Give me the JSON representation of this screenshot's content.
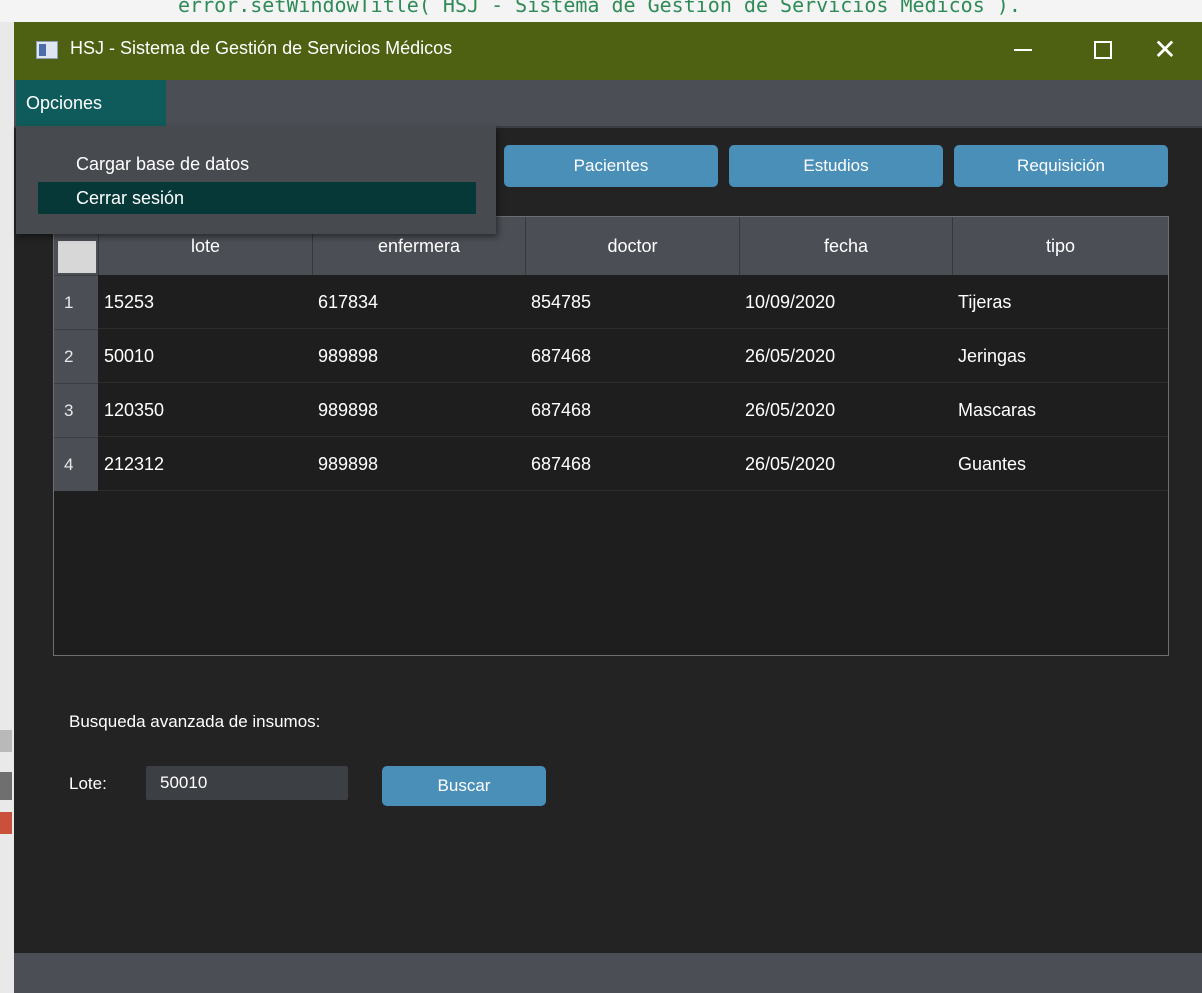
{
  "background": {
    "code_line": "error.setWindowTitle( HSJ - Sistema de Gestion de Servicios Medicos )."
  },
  "window": {
    "title": "HSJ - Sistema de Gestión de Servicios Médicos",
    "close_glyph": "✕"
  },
  "menu": {
    "opciones": "Opciones",
    "items": [
      {
        "label": "Cargar base de datos"
      },
      {
        "label": "Cerrar sesión"
      }
    ]
  },
  "toolbar": {
    "pacientes": "Pacientes",
    "estudios": "Estudios",
    "requisicion": "Requisición"
  },
  "table": {
    "columns": [
      "lote",
      "enfermera",
      "doctor",
      "fecha",
      "tipo"
    ],
    "rows": [
      {
        "num": "1",
        "cells": [
          "15253",
          "617834",
          "854785",
          "10/09/2020",
          "Tijeras"
        ]
      },
      {
        "num": "2",
        "cells": [
          "50010",
          "989898",
          "687468",
          "26/05/2020",
          "Jeringas"
        ]
      },
      {
        "num": "3",
        "cells": [
          "120350",
          "989898",
          "687468",
          "26/05/2020",
          "Mascaras"
        ]
      },
      {
        "num": "4",
        "cells": [
          "212312",
          "989898",
          "687468",
          "26/05/2020",
          "Guantes"
        ]
      }
    ]
  },
  "search": {
    "heading": "Busqueda avanzada de insumos:",
    "lote_label": "Lote:",
    "lote_value": "50010",
    "buscar": "Buscar"
  },
  "colors": {
    "titlebar": "#4e6112",
    "menu_active": "#0f5b5b",
    "button": "#4a8fb8",
    "window_bg": "#232323"
  }
}
